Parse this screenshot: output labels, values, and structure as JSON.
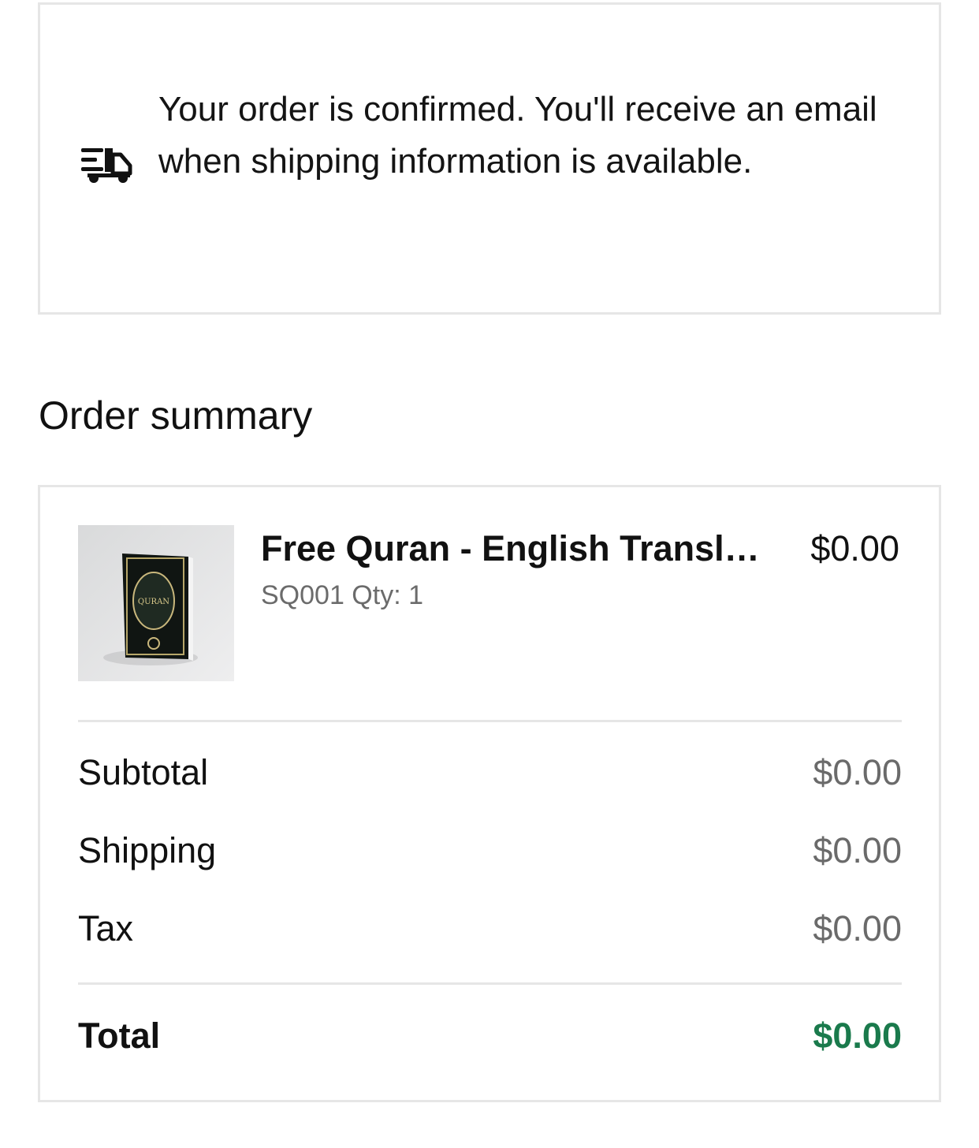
{
  "confirmation": {
    "icon": "truck-icon",
    "message": "Your order is confirmed. You'll receive an email when shipping information is available."
  },
  "order_summary": {
    "title": "Order summary",
    "item": {
      "name": "Free Quran - English Translation",
      "price": "$0.00",
      "sku_qty": "SQ001 Qty: 1",
      "image_label": "QURAN"
    },
    "subtotal": {
      "label": "Subtotal",
      "value": "$0.00"
    },
    "shipping": {
      "label": "Shipping",
      "value": "$0.00"
    },
    "tax": {
      "label": "Tax",
      "value": "$0.00"
    },
    "total": {
      "label": "Total",
      "value": "$0.00"
    }
  },
  "colors": {
    "total_accent": "#1a7a4c",
    "border": "#e6e6e6",
    "muted_text": "#6a6a6a"
  }
}
